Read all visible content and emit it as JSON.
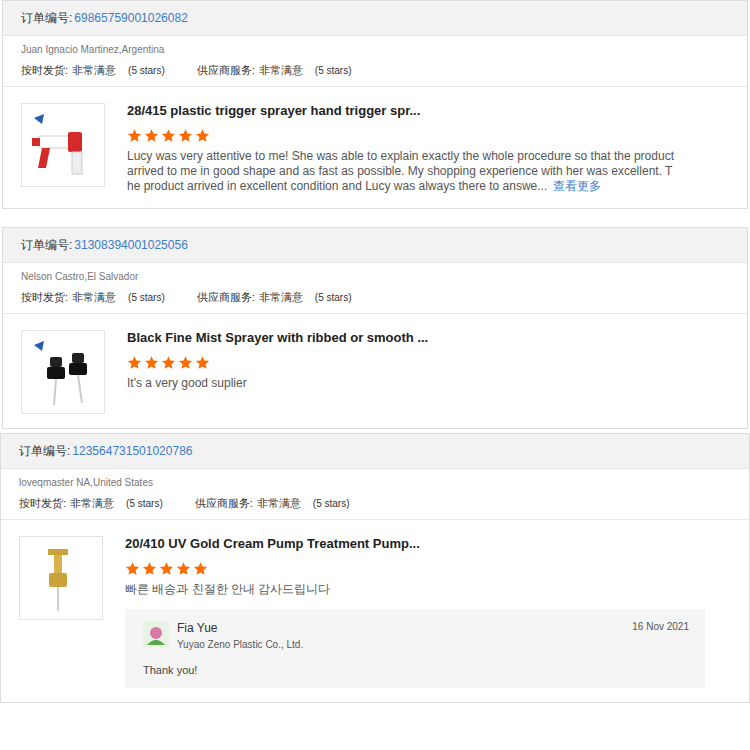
{
  "orders": [
    {
      "order_label": "订单编号:",
      "order_number": "69865759001026082",
      "buyer": "Juan Ignacio Martinez,Argentina",
      "ratings": [
        {
          "label": "按时发货:",
          "value": "非常满意",
          "note": "(5 stars)"
        },
        {
          "label": "供应商服务:",
          "value": "非常满意",
          "note": "(5 stars)"
        }
      ],
      "product": {
        "kind": "trigger",
        "title": "28/415 plastic trigger sprayer hand trigger spr...",
        "stars": 5
      },
      "review": "Lucy was very attentive to me! She was able to explain exactly the whole procedure so that the product arrived to me in good shape and as fast as possible. My shopping experience with her was excellent. The product arrived in excellent condition and Lucy was always there to answe...",
      "more_link": "查看更多"
    },
    {
      "order_label": "订单编号:",
      "order_number": "31308394001025056",
      "buyer": "Nelson Castro,El Salvador",
      "ratings": [
        {
          "label": "按时发货:",
          "value": "非常满意",
          "note": "(5 stars)"
        },
        {
          "label": "供应商服务:",
          "value": "非常满意",
          "note": "(5 stars)"
        }
      ],
      "product": {
        "kind": "mist",
        "title": "Black Fine Mist Sprayer with ribbed or smooth ...",
        "stars": 5
      },
      "review": "It's a very good suplier"
    },
    {
      "order_label": "订单编号:",
      "order_number": "123564731501020786",
      "buyer": "loveqmaster NA,United States",
      "ratings": [
        {
          "label": "按时发货:",
          "value": "非常满意",
          "note": "(5 stars)"
        },
        {
          "label": "供应商服务:",
          "value": "非常满意",
          "note": "(5 stars)"
        }
      ],
      "product": {
        "kind": "pump",
        "title": "20/410 UV Gold Cream Pump Treatment Pump...",
        "stars": 5
      },
      "review": "빠른 배송과 친절한 안내 감사드립니다",
      "reply": {
        "name": "Fia Yue",
        "company": "Yuyao Zeno Plastic Co., Ltd.",
        "date": "16 Nov 2021",
        "text": "Thank you!"
      }
    }
  ]
}
